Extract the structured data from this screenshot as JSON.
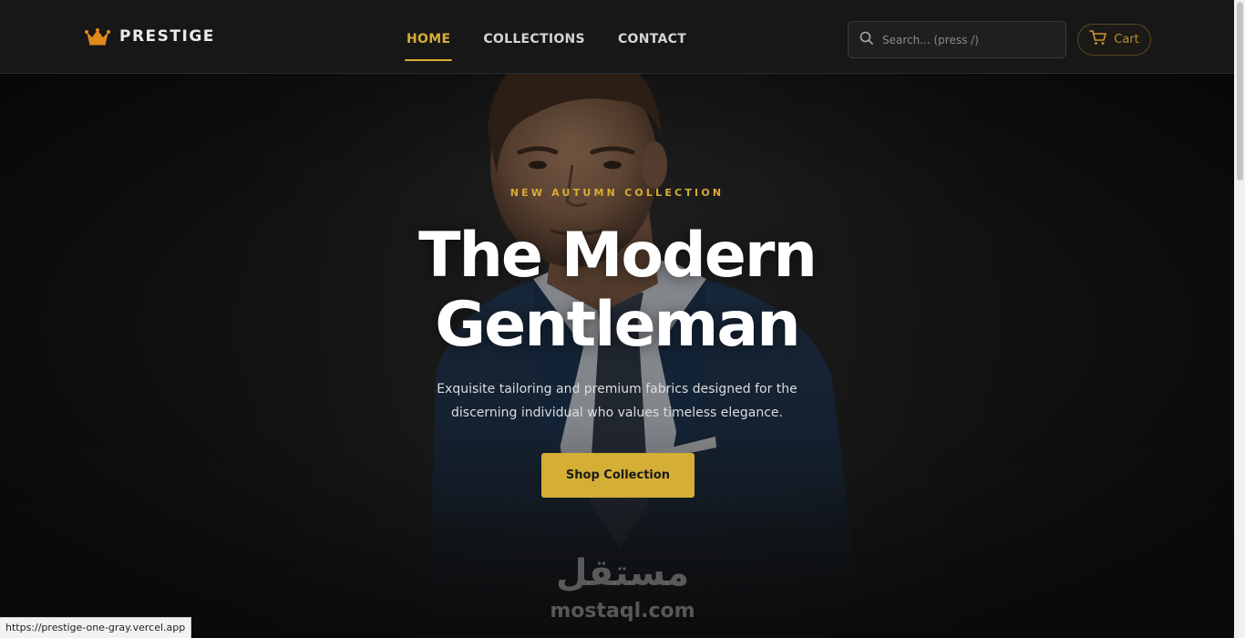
{
  "brand": {
    "name": "PRESTIGE",
    "logo_icon": "crown-icon",
    "accent_color": "#d9ad34"
  },
  "nav": {
    "items": [
      {
        "label": "HOME",
        "active": true
      },
      {
        "label": "COLLECTIONS",
        "active": false
      },
      {
        "label": "CONTACT",
        "active": false
      }
    ]
  },
  "search": {
    "placeholder": "Search... (press /)",
    "icon": "search-icon"
  },
  "cart": {
    "label": "Cart",
    "icon": "cart-icon"
  },
  "hero": {
    "eyebrow": "NEW AUTUMN COLLECTION",
    "title_line1": "The Modern",
    "title_line2": "Gentleman",
    "subtitle": "Exquisite tailoring and premium fabrics designed for the discerning individual who values timeless elegance.",
    "cta_label": "Shop Collection",
    "cta_color": "#d4ae35"
  },
  "watermark": {
    "arabic": "مستقل",
    "latin": "mostaql.com"
  },
  "status_bar": {
    "url": "https://prestige-one-gray.vercel.app"
  }
}
